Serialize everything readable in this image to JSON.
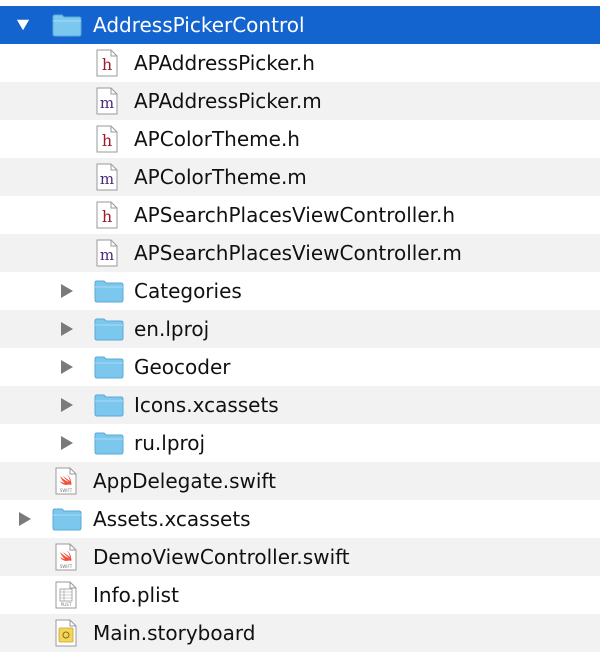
{
  "navigator": {
    "rows": [
      {
        "label": "AddressPickerControl",
        "kind": "folder",
        "expanded": true,
        "selected": true,
        "depth": 0
      },
      {
        "label": "APAddressPicker.h",
        "kind": "header-file",
        "glyph": "h",
        "depth": 2
      },
      {
        "label": "APAddressPicker.m",
        "kind": "objc-file",
        "glyph": "m",
        "depth": 2
      },
      {
        "label": "APColorTheme.h",
        "kind": "header-file",
        "glyph": "h",
        "depth": 2
      },
      {
        "label": "APColorTheme.m",
        "kind": "objc-file",
        "glyph": "m",
        "depth": 2
      },
      {
        "label": "APSearchPlacesViewController.h",
        "kind": "header-file",
        "glyph": "h",
        "depth": 2
      },
      {
        "label": "APSearchPlacesViewController.m",
        "kind": "objc-file",
        "glyph": "m",
        "depth": 2
      },
      {
        "label": "Categories",
        "kind": "folder",
        "expanded": false,
        "depth": 1
      },
      {
        "label": "en.lproj",
        "kind": "folder",
        "expanded": false,
        "depth": 1
      },
      {
        "label": "Geocoder",
        "kind": "folder",
        "expanded": false,
        "depth": 1
      },
      {
        "label": "Icons.xcassets",
        "kind": "folder",
        "expanded": false,
        "depth": 1
      },
      {
        "label": "ru.lproj",
        "kind": "folder",
        "expanded": false,
        "depth": 1
      },
      {
        "label": "AppDelegate.swift",
        "kind": "swift-file",
        "icon_caption": "SWIFT",
        "depth": 0
      },
      {
        "label": "Assets.xcassets",
        "kind": "folder",
        "expanded": false,
        "depth": 0
      },
      {
        "label": "DemoViewController.swift",
        "kind": "swift-file",
        "icon_caption": "SWIFT",
        "depth": 0
      },
      {
        "label": "Info.plist",
        "kind": "plist-file",
        "icon_caption": "PLIST",
        "depth": 0
      },
      {
        "label": "Main.storyboard",
        "kind": "storyboard-file",
        "depth": 0
      }
    ]
  },
  "colors": {
    "selection": "#1464d0",
    "alt_row": "#f2f2f2",
    "folder": "#6cc3f0",
    "header_glyph": "#9b1c2c",
    "objc_glyph": "#4a2a80",
    "swift": "#f05138",
    "disclosure": "#7a7a7a"
  }
}
